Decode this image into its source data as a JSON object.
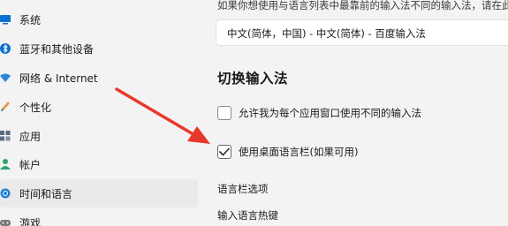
{
  "sidebar": {
    "items": [
      {
        "label": "系统",
        "icon": "display-icon",
        "color": "#0078d4"
      },
      {
        "label": "蓝牙和其他设备",
        "icon": "bluetooth-icon",
        "color": "#0078d4"
      },
      {
        "label": "网络 & Internet",
        "icon": "wifi-icon",
        "color": "#2b88d8"
      },
      {
        "label": "个性化",
        "icon": "pen-icon",
        "color": "#d18a3a"
      },
      {
        "label": "应用",
        "icon": "apps-icon",
        "color": "#6b6b6b"
      },
      {
        "label": "帐户",
        "icon": "person-icon",
        "color": "#2ea36b"
      },
      {
        "label": "时间和语言",
        "icon": "globe-clock-icon",
        "color": "#0078d4",
        "selected": true
      },
      {
        "label": "游戏",
        "icon": "gamepad-icon",
        "color": "#7a7a7a"
      }
    ]
  },
  "main": {
    "hint_text": "如果你想使用与语言列表中最靠前的输入法不同的输入法，请在此",
    "default_ime_value": "中文(简体，中国) - 中文(简体) - 百度输入法",
    "section_title": "切换输入法",
    "checkbox_per_app": {
      "label": "允许我为每个应用窗口使用不同的输入法",
      "checked": false
    },
    "checkbox_langbar": {
      "label": "使用桌面语言栏(如果可用)",
      "checked": true
    },
    "link_langbar_options": "语言栏选项",
    "link_hotkeys": "输入语言热键"
  },
  "annotation": {
    "arrow_color": "#e8382c"
  }
}
